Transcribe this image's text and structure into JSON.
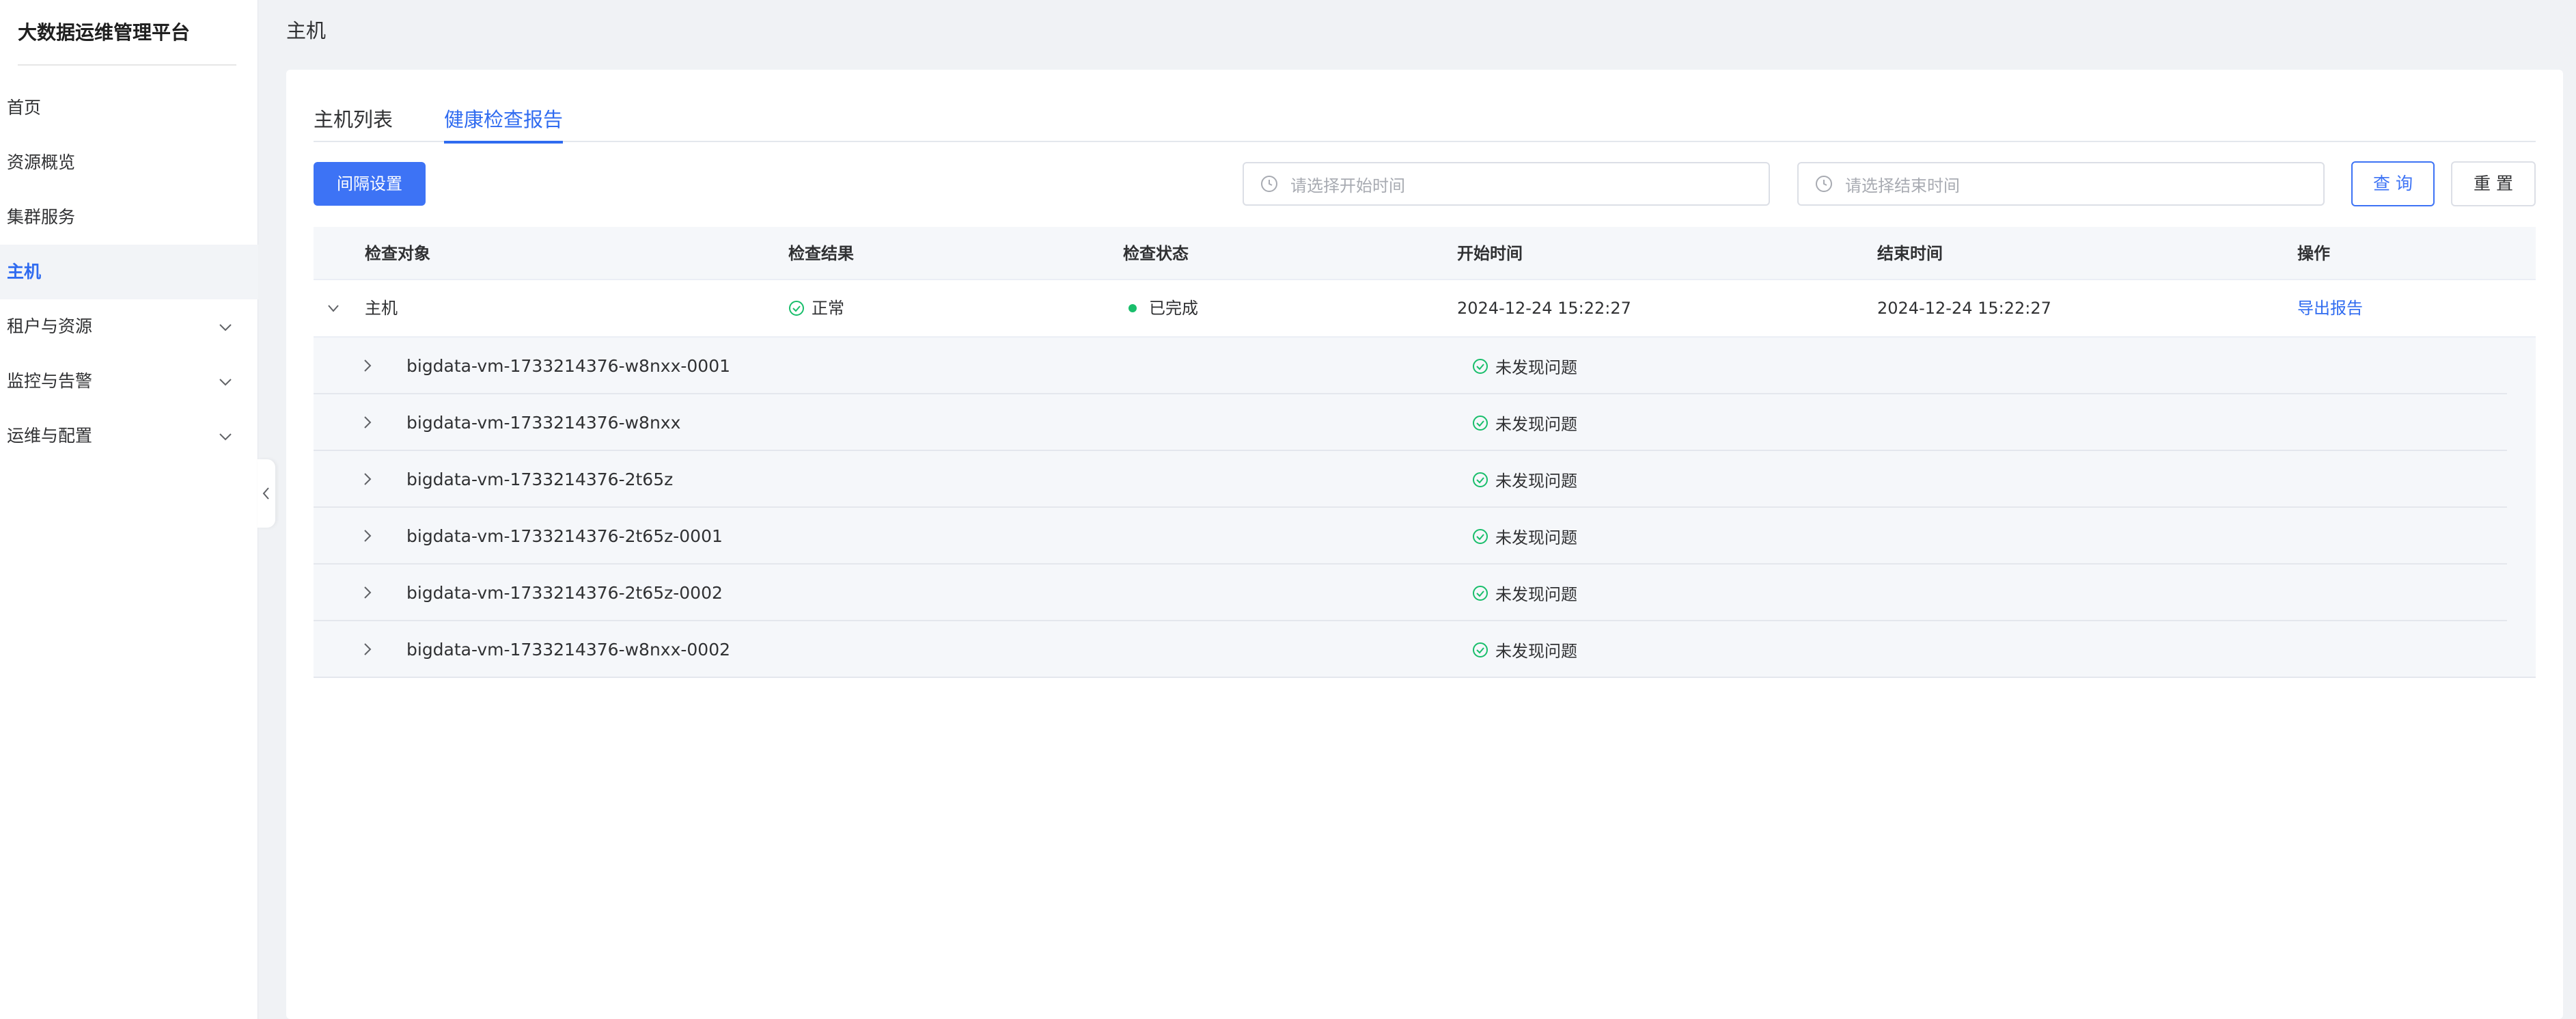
{
  "sidebar": {
    "brand": "大数据运维管理平台",
    "items": [
      {
        "label": "首页"
      },
      {
        "label": "资源概览"
      },
      {
        "label": "集群服务"
      },
      {
        "label": "主机"
      },
      {
        "label": "租户与资源"
      },
      {
        "label": "监控与告警"
      },
      {
        "label": "运维与配置"
      }
    ]
  },
  "header": {
    "title": "主机"
  },
  "tabs": [
    {
      "label": "主机列表"
    },
    {
      "label": "健康检查报告"
    }
  ],
  "toolbar": {
    "interval_button": "间隔设置",
    "start_placeholder": "请选择开始时间",
    "end_placeholder": "请选择结束时间",
    "query_button": "查 询",
    "reset_button": "重 置"
  },
  "table": {
    "columns": [
      "检查对象",
      "检查结果",
      "检查状态",
      "开始时间",
      "结束时间",
      "操作"
    ],
    "row": {
      "object": "主机",
      "result": "正常",
      "status": "已完成",
      "start_time": "2024-12-24 15:22:27",
      "end_time": "2024-12-24 15:22:27",
      "action": "导出报告"
    },
    "sub_rows": [
      {
        "name": "bigdata-vm-1733214376-w8nxx-0001",
        "status": "未发现问题"
      },
      {
        "name": "bigdata-vm-1733214376-w8nxx",
        "status": "未发现问题"
      },
      {
        "name": "bigdata-vm-1733214376-2t65z",
        "status": "未发现问题"
      },
      {
        "name": "bigdata-vm-1733214376-2t65z-0001",
        "status": "未发现问题"
      },
      {
        "name": "bigdata-vm-1733214376-2t65z-0002",
        "status": "未发现问题"
      },
      {
        "name": "bigdata-vm-1733214376-w8nxx-0002",
        "status": "未发现问题"
      }
    ]
  },
  "colors": {
    "accent": "#2f6bf0",
    "success": "#19be6b"
  }
}
